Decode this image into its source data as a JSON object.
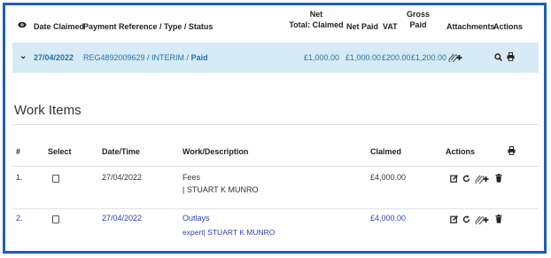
{
  "claims_table": {
    "headers": {
      "date_claimed": "Date Claimed",
      "payment_ref": "Payment Reference / Type / Status",
      "net_total_line1": "Net",
      "net_total_line2": "Total: Claimed",
      "net_paid": "Net Paid",
      "vat": "VAT",
      "gross_line1": "Gross",
      "gross_line2": "Paid",
      "attachments": "Attachments",
      "actions": "Actions"
    },
    "row": {
      "date": "27/04/2022",
      "reference": "REG4892009629 / INTERIM / ",
      "status": "Paid",
      "net_claimed": "£1,000.00",
      "net_paid": "£1,000.00",
      "vat": "£200.00",
      "gross_paid": "£1,200.00"
    }
  },
  "work_items": {
    "title": "Work Items",
    "headers": {
      "num": "#",
      "select": "Select",
      "datetime": "Date/Time",
      "work": "Work/Description",
      "claimed": "Claimed",
      "actions": "Actions"
    },
    "rows": [
      {
        "num": "1.",
        "date": "27/04/2022",
        "work": "Fees",
        "desc_prefix": "",
        "desc": "| STUART K MUNRO",
        "claimed": "£4,000.00"
      },
      {
        "num": "2.",
        "date": "27/04/2022",
        "work": "Outlays",
        "desc_prefix": "expert",
        "desc": "| STUART K MUNRO",
        "claimed": "£4,000.00"
      }
    ]
  },
  "colors": {
    "frame_border": "#1f5fb4",
    "selected_row_bg": "#d6ebf5",
    "link_text": "#2b3fae",
    "ref_text": "#2a6fa8"
  }
}
